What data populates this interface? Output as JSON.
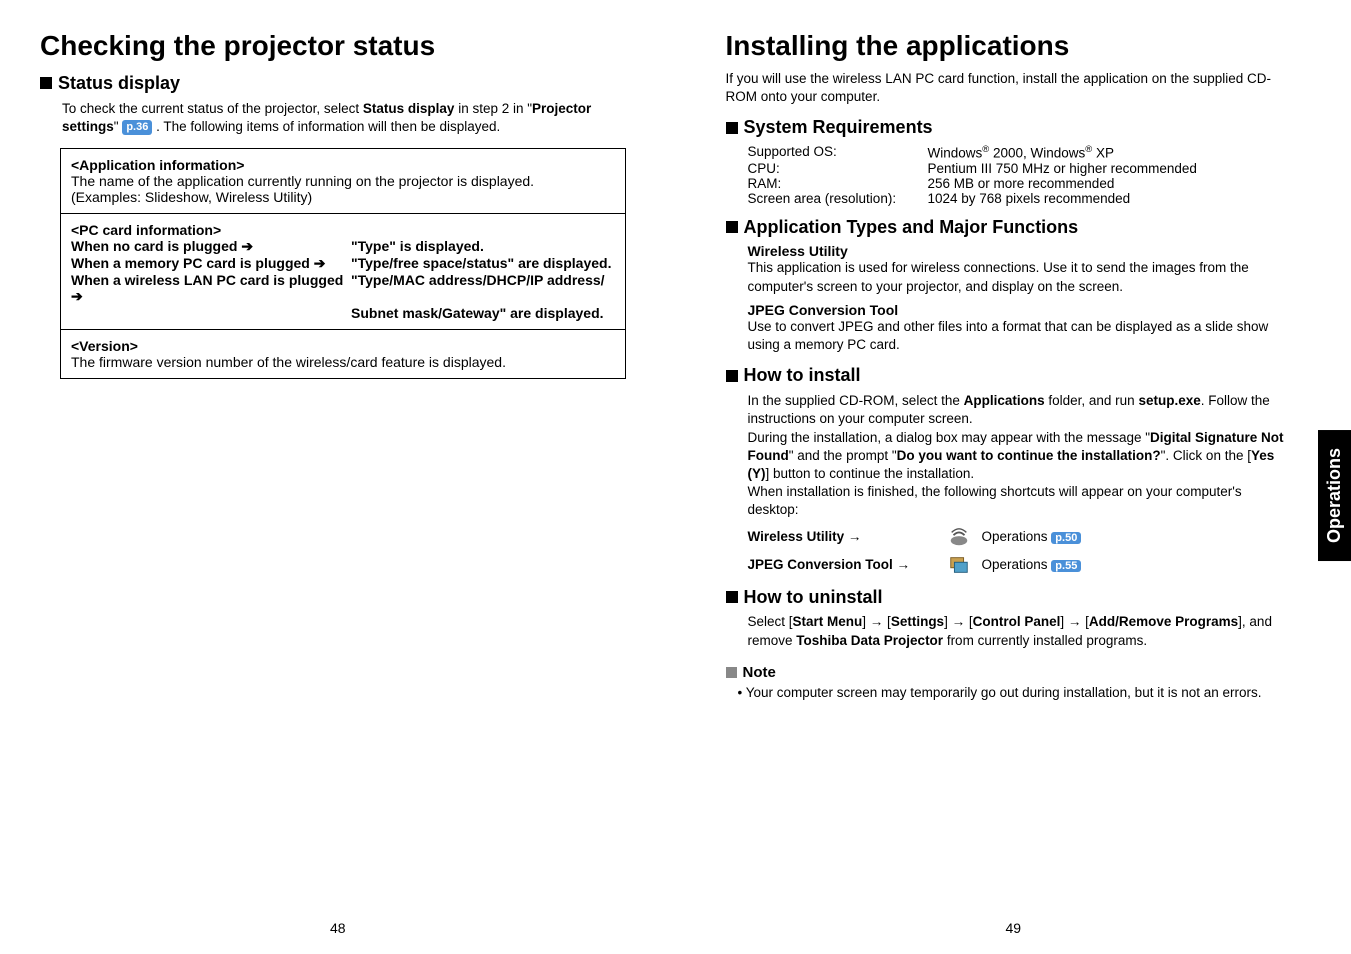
{
  "left": {
    "title": "Checking the projector status",
    "status_heading": "Status display",
    "intro_pre": "To check the current status of the projector, select ",
    "intro_bold1": "Status display",
    "intro_mid": " in step 2 in \"",
    "intro_bold2": "Projector settings",
    "intro_end": "\" ",
    "pref": "p.36",
    "intro_after": " . The following items of information will then be displayed.",
    "box": {
      "app_title": "<Application information>",
      "app_body": "The name of the application currently running on the projector is displayed.\n(Examples: Slideshow, Wireless Utility)",
      "pc_title": "<PC card information>",
      "pc_rows": [
        {
          "l": "When no card is plugged ➔",
          "r": "\"Type\" is displayed."
        },
        {
          "l": "When a memory PC card is plugged ➔",
          "r": "\"Type/free space/status\" are displayed."
        },
        {
          "l": "When a wireless LAN PC card is plugged ➔",
          "r": "\"Type/MAC address/DHCP/IP address/"
        },
        {
          "l": "",
          "r": "Subnet mask/Gateway\" are displayed."
        }
      ],
      "ver_title": "<Version>",
      "ver_body": "The firmware version number of the wireless/card feature is displayed."
    },
    "pagenum": "48"
  },
  "right": {
    "title": "Installing the applications",
    "intro": "If you will use the wireless LAN PC card function, install the application on the supplied CD-ROM onto your computer.",
    "sysreq_heading": "System Requirements",
    "sysreq": [
      {
        "label": "Supported OS:",
        "value_pre": "Windows",
        "value_sup1": "®",
        "value_mid": " 2000, Windows",
        "value_sup2": "®",
        "value_end": " XP"
      },
      {
        "label": "CPU:",
        "value": "Pentium III 750 MHz or higher recommended"
      },
      {
        "label": "RAM:",
        "value": "256 MB or more recommended"
      },
      {
        "label": "Screen area (resolution):",
        "value": "1024 by 768 pixels recommended"
      }
    ],
    "apptypes_heading": "Application Types and Major Functions",
    "apptypes": [
      {
        "title": "Wireless Utility",
        "body": "This application is used for wireless connections. Use it to send the images from the computer's screen to your projector, and display on the screen."
      },
      {
        "title": "JPEG Conversion Tool",
        "body": "Use to convert JPEG and other files into a format that can be displayed as a slide show using a memory PC card."
      }
    ],
    "install_heading": "How to install",
    "install_p1_pre": "In the supplied CD-ROM, select the ",
    "install_p1_b1": "Applications",
    "install_p1_mid": " folder, and run ",
    "install_p1_b2": "setup.exe",
    "install_p1_end": ". Follow the instructions on your computer screen.",
    "install_p2_pre": "During the installation, a dialog box may appear with the message \"",
    "install_p2_b1": "Digital Signature Not Found",
    "install_p2_mid": "\" and the prompt \"",
    "install_p2_b2": "Do you want to continue the installation?",
    "install_p2_after": "\". Click on the [",
    "install_p2_b3": "Yes (Y)",
    "install_p2_end": "] button to continue the installation.",
    "install_p3": "When installation is finished, the following shortcuts will appear on your computer's desktop:",
    "shortcuts": [
      {
        "label": "Wireless Utility →",
        "ops": "Operations ",
        "pref": "p.50"
      },
      {
        "label": "JPEG Conversion Tool →",
        "ops": "Operations ",
        "pref": "p.55"
      }
    ],
    "uninstall_heading": "How to uninstall",
    "uninstall_pre": "Select [",
    "uninstall_b1": "Start Menu",
    "uninstall_a1": "] → [",
    "uninstall_b2": "Settings",
    "uninstall_a2": "] → [",
    "uninstall_b3": "Control Panel",
    "uninstall_a3": "] → [",
    "uninstall_b4": "Add/Remove Programs",
    "uninstall_a4": "], and remove ",
    "uninstall_b5": "Toshiba Data Projector",
    "uninstall_end": " from currently installed programs.",
    "note_heading": "Note",
    "note_item": "Your computer screen may temporarily go out during installation, but it is not an errors.",
    "sidetab": "Operations",
    "pagenum": "49"
  }
}
